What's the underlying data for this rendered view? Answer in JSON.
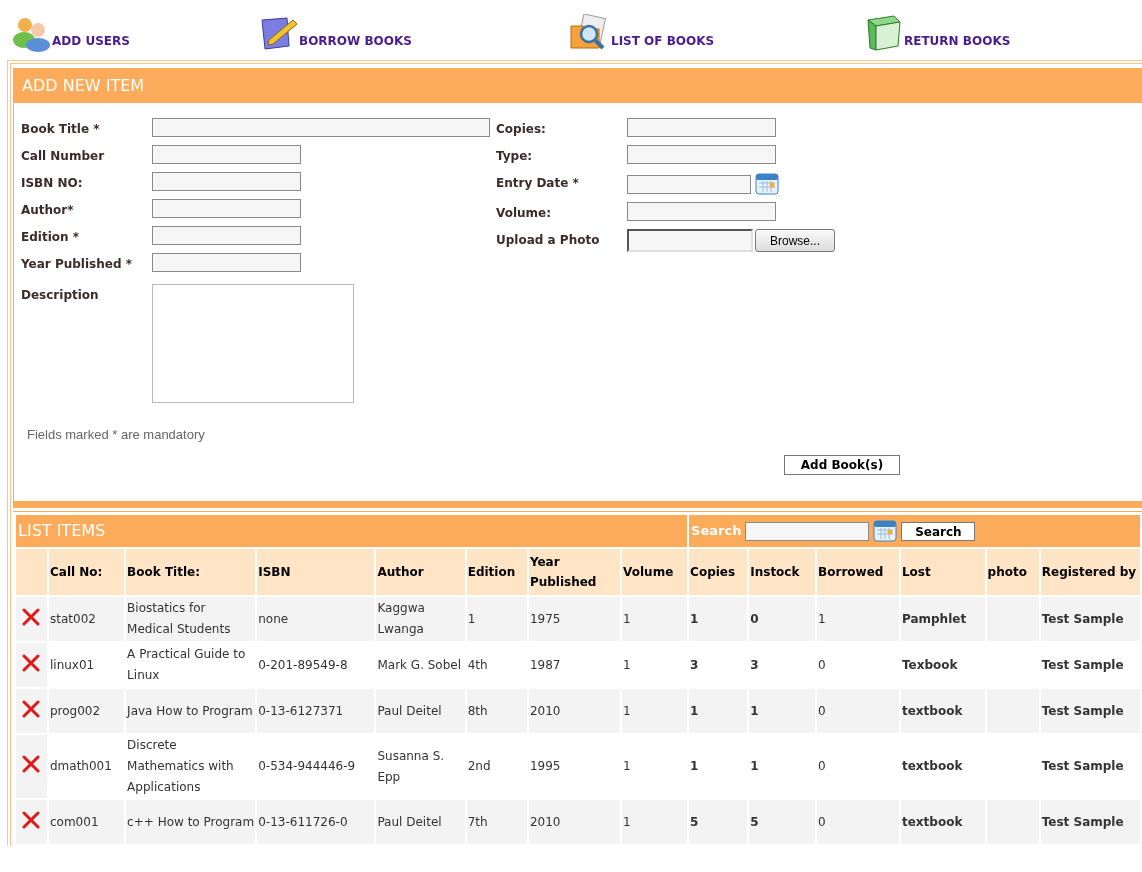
{
  "nav": [
    {
      "label": "ADD USERS"
    },
    {
      "label": "BORROW BOOKS"
    },
    {
      "label": "LIST OF BOOKS"
    },
    {
      "label": "RETURN BOOKS"
    }
  ],
  "form": {
    "title": "ADD NEW ITEM",
    "left_fields": [
      {
        "label": "Book Title *",
        "kind": "wide"
      },
      {
        "label": "Call Number",
        "kind": "text"
      },
      {
        "label": "ISBN NO:",
        "kind": "text"
      },
      {
        "label": "Author*",
        "kind": "text"
      },
      {
        "label": "Edition *",
        "kind": "text"
      },
      {
        "label": "Year Published *",
        "kind": "text"
      },
      {
        "label": "Description",
        "kind": "textarea"
      }
    ],
    "right_fields": [
      {
        "label": "Copies:",
        "kind": "text"
      },
      {
        "label": "Type:",
        "kind": "text"
      },
      {
        "label": "Entry Date *",
        "kind": "date"
      },
      {
        "label": "Volume:",
        "kind": "text"
      },
      {
        "label": "Upload a Photo",
        "kind": "file",
        "button": "Browse..."
      }
    ],
    "note": "Fields marked * are mandatory",
    "submit": "Add Book(s)"
  },
  "list": {
    "title": "LIST ITEMS",
    "search_label": "Search",
    "search_button": "Search",
    "columns": [
      "Call No:",
      "Book Title:",
      "ISBN",
      "Author",
      "Edition",
      "Year Published",
      "Volume",
      "Copies",
      "Instock",
      "Borrowed",
      "Lost",
      "photo",
      "Registered by"
    ],
    "rows": [
      [
        "stat002",
        "Biostatics for Medical Students",
        "none",
        "Kaggwa Lwanga",
        "1",
        "1975",
        "1",
        "1",
        "0",
        "1",
        "Pamphlet",
        "",
        "Test Sample"
      ],
      [
        "linux01",
        "A Practical Guide to Linux",
        "0-201-89549-8",
        "Mark G. Sobel",
        "4th",
        "1987",
        "1",
        "3",
        "3",
        "0",
        "Texbook",
        "",
        "Test Sample"
      ],
      [
        "prog002",
        "Java How to Program",
        "0-13-6127371",
        "Paul Deitel",
        "8th",
        "2010",
        "1",
        "1",
        "1",
        "0",
        "textbook",
        "",
        "Test Sample"
      ],
      [
        "dmath001",
        "Discrete Mathematics with Applications",
        "0-534-944446-9",
        "Susanna S. Epp",
        "2nd",
        "1995",
        "1",
        "1",
        "1",
        "0",
        "textbook",
        "",
        "Test Sample"
      ],
      [
        "com001",
        "c++ How to Program",
        "0-13-611726-0",
        "Paul Deitel",
        "7th",
        "2010",
        "1",
        "5",
        "5",
        "0",
        "textbook",
        "",
        "Test Sample"
      ]
    ]
  }
}
